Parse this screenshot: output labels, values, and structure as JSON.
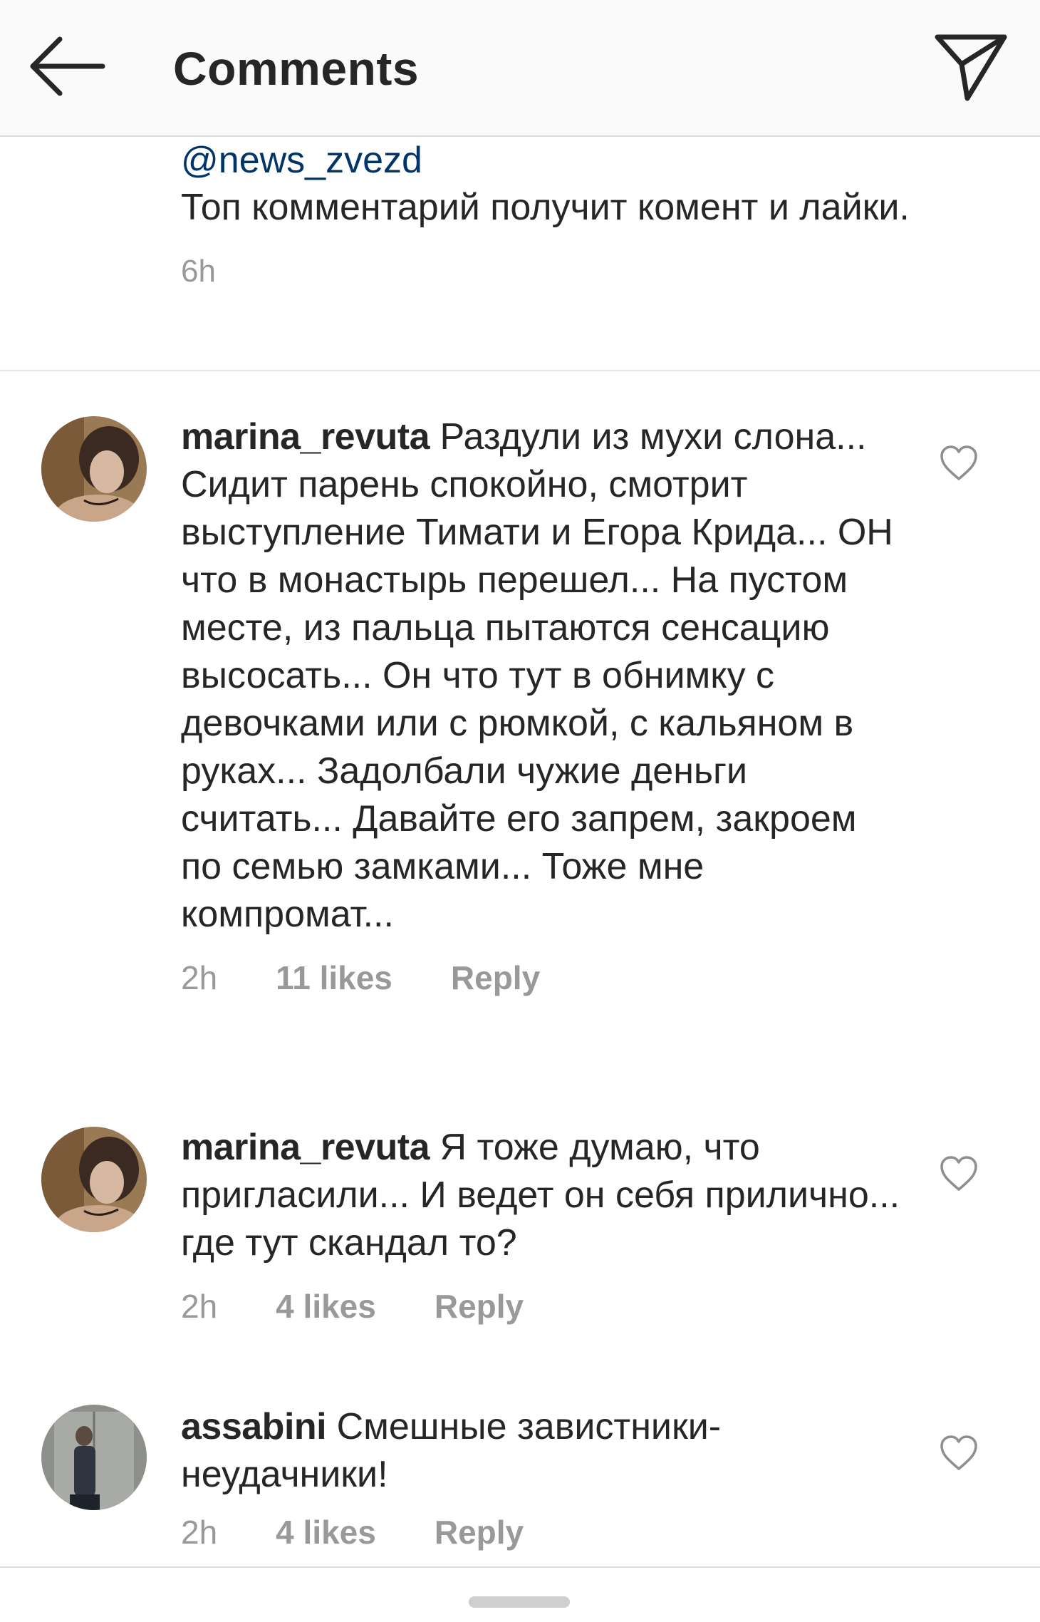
{
  "header": {
    "title": "Comments",
    "back_icon": "arrow-left-icon",
    "share_icon": "paper-plane-icon"
  },
  "caption": {
    "mention": "@news_zvezd",
    "text": "Топ комментарий получит комент и лайки.",
    "time": "6h"
  },
  "comments": [
    {
      "username": "marina_revuta",
      "text": "Раздули из мухи слона... Сидит парень  спокойно, смотрит выступление Тимати и Егора Крида... ОН что в монастырь перешел... На пустом месте, из пальца пытаются сенсацию высосать... Он что тут в обнимку с девочками или с рюмкой, с кальяном в руках... Задолбали чужие деньги считать... Давайте его запрем, закроем по семью замками... Тоже мне компромат...",
      "time": "2h",
      "likes": "11 likes",
      "reply": "Reply"
    },
    {
      "username": "marina_revuta",
      "text": "Я тоже думаю, что пригласили... И ведет он себя прилично... где тут скандал то?",
      "time": "2h",
      "likes": "4 likes",
      "reply": "Reply"
    },
    {
      "username": "assabini",
      "text": "Смешные завистники-неудачники!",
      "time": "2h",
      "likes": "4 likes",
      "reply": "Reply"
    }
  ],
  "colors": {
    "text": "#262626",
    "muted": "#999999",
    "mention": "#003569",
    "header_bg": "#fafafa"
  }
}
